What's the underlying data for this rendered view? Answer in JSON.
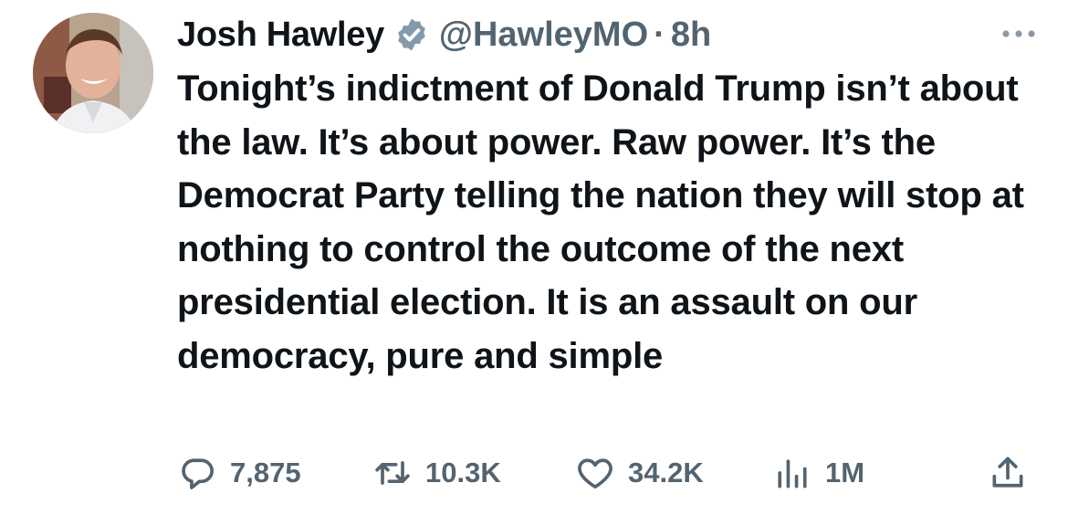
{
  "tweet": {
    "author": {
      "name": "Josh Hawley",
      "handle": "@HawleyMO",
      "verified": true
    },
    "separator": "·",
    "time": "8h",
    "text": "Tonight’s indictment of Donald Trump isn’t about the law. It’s about power. Raw power. It’s the Democrat Party telling the nation they will stop at nothing to control the outcome of the next presidential election. It is an assault on our democracy, pure and simple",
    "stats": {
      "replies": "7,875",
      "reposts": "10.3K",
      "likes": "34.2K",
      "views": "1M"
    }
  },
  "icons": {
    "verified": "verified-badge-icon",
    "more": "more-options-icon",
    "reply": "reply-icon",
    "retweet": "retweet-icon",
    "like": "heart-icon",
    "views": "views-bar-chart-icon",
    "share": "share-icon"
  },
  "colors": {
    "text": "#0f1419",
    "secondary": "#536471",
    "verified_badge": "#829aab",
    "background": "#ffffff"
  }
}
